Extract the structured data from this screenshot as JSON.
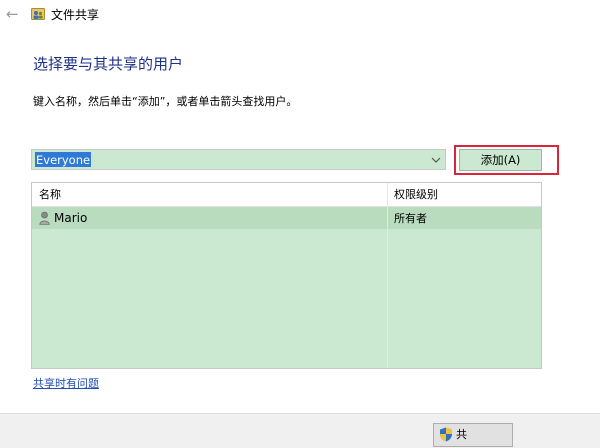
{
  "window": {
    "title": "文件共享",
    "back_icon": "back-arrow-icon",
    "app_icon": "file-sharing-icon"
  },
  "page": {
    "heading": "选择要与其共享的用户",
    "instruction": "键入名称，然后单击“添加”，或者单击箭头查找用户。"
  },
  "name_input": {
    "value": "Everyone",
    "dropdown_icon": "chevron-down-icon"
  },
  "add_button": {
    "label": "添加(A)"
  },
  "table": {
    "columns": [
      "名称",
      "权限级别"
    ],
    "rows": [
      {
        "name": "Mario",
        "permission": "所有者",
        "icon": "user-icon"
      }
    ]
  },
  "help_link": {
    "label": "共享时有问题"
  },
  "footer": {
    "share_button_label": "共",
    "share_icon": "uac-shield-icon"
  },
  "colors": {
    "heading": "#1e3287",
    "highlight_outline": "#d9263a",
    "link": "#1f4fb4",
    "selection": "#2f7ad6",
    "list_background": "#cbe9d1",
    "selected_row": "#b9dcbf"
  }
}
